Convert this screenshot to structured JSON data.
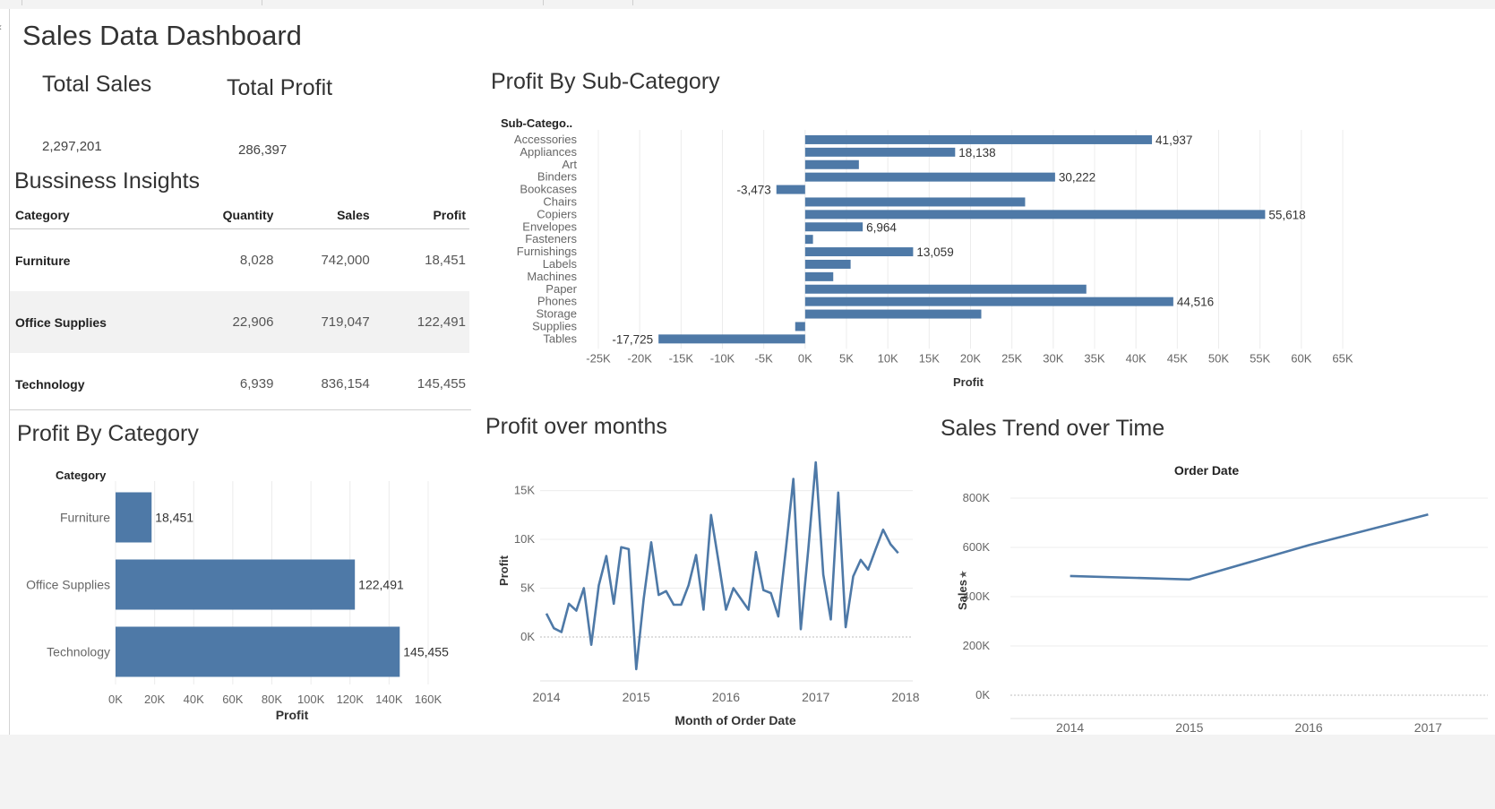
{
  "dashboard": {
    "title": "Sales Data Dashboard"
  },
  "kpis": {
    "total_sales": {
      "label": "Total Sales",
      "value": "2,297,201"
    },
    "total_profit": {
      "label": "Total Profit",
      "value": "286,397"
    }
  },
  "insights": {
    "title": "Bussiness Insights",
    "columns": [
      "Category",
      "Quantity",
      "Sales",
      "Profit"
    ],
    "rows": [
      [
        "Furniture",
        "8,028",
        "742,000",
        "18,451"
      ],
      [
        "Office Supplies",
        "22,906",
        "719,047",
        "122,491"
      ],
      [
        "Technology",
        "6,939",
        "836,154",
        "145,455"
      ]
    ]
  },
  "colors": {
    "bar": "#4e79a7",
    "grid": "#ececec",
    "zero_line": "#bdbdbd"
  },
  "chart_data": [
    {
      "id": "subcat",
      "type": "bar",
      "orientation": "horizontal",
      "title": "Profit By Sub-Category",
      "row_header": "Sub-Catego..",
      "xlabel": "Profit",
      "xlim": [
        -25000,
        65000
      ],
      "xticks": [
        "-25K",
        "-20K",
        "-15K",
        "-10K",
        "-5K",
        "0K",
        "5K",
        "10K",
        "15K",
        "20K",
        "25K",
        "30K",
        "35K",
        "40K",
        "45K",
        "50K",
        "55K",
        "60K",
        "65K"
      ],
      "categories": [
        "Accessories",
        "Appliances",
        "Art",
        "Binders",
        "Bookcases",
        "Chairs",
        "Copiers",
        "Envelopes",
        "Fasteners",
        "Furnishings",
        "Labels",
        "Machines",
        "Paper",
        "Phones",
        "Storage",
        "Supplies",
        "Tables"
      ],
      "values": [
        41937,
        18138,
        6500,
        30222,
        -3473,
        26600,
        55618,
        6964,
        950,
        13059,
        5500,
        3400,
        34000,
        44516,
        21300,
        -1200,
        -17725
      ],
      "labels": [
        "41,937",
        "18,138",
        "",
        "30,222",
        "-3,473",
        "",
        "55,618",
        "6,964",
        "",
        "13,059",
        "",
        "",
        "",
        "44,516",
        "",
        "",
        "-17,725"
      ],
      "grid": true,
      "legend": "none"
    },
    {
      "id": "category",
      "type": "bar",
      "orientation": "horizontal",
      "title": "Profit By Category",
      "row_header": "Category",
      "xlabel": "Profit",
      "xlim": [
        0,
        160000
      ],
      "xticks": [
        "0K",
        "20K",
        "40K",
        "60K",
        "80K",
        "100K",
        "120K",
        "140K",
        "160K"
      ],
      "categories": [
        "Furniture",
        "Office Supplies",
        "Technology"
      ],
      "values": [
        18451,
        122491,
        145455
      ],
      "labels": [
        "18,451",
        "122,491",
        "145,455"
      ],
      "grid": true,
      "legend": "none"
    },
    {
      "id": "months",
      "type": "line",
      "title": "Profit over months",
      "xlabel": "Month of Order Date",
      "ylabel": "Profit",
      "ylim": [
        -4500,
        17900
      ],
      "yticks": [
        "0K",
        "5K",
        "10K",
        "15K"
      ],
      "xticks": [
        "2014",
        "2015",
        "2016",
        "2017",
        "2018"
      ],
      "x": [
        2014.0,
        2014.083,
        2014.167,
        2014.25,
        2014.333,
        2014.417,
        2014.5,
        2014.583,
        2014.667,
        2014.75,
        2014.833,
        2014.917,
        2015.0,
        2015.083,
        2015.167,
        2015.25,
        2015.333,
        2015.417,
        2015.5,
        2015.583,
        2015.667,
        2015.75,
        2015.833,
        2015.917,
        2016.0,
        2016.083,
        2016.167,
        2016.25,
        2016.333,
        2016.417,
        2016.5,
        2016.583,
        2016.667,
        2016.75,
        2016.833,
        2016.917,
        2017.0,
        2017.083,
        2017.167,
        2017.25,
        2017.333,
        2017.417,
        2017.5,
        2017.583,
        2017.667,
        2017.75,
        2017.833,
        2017.917
      ],
      "values": [
        2400,
        900,
        500,
        3400,
        2700,
        5000,
        -800,
        5300,
        8300,
        3400,
        9200,
        9000,
        -3300,
        3900,
        9700,
        4300,
        4700,
        3300,
        3300,
        5300,
        8400,
        2800,
        12500,
        7700,
        2800,
        5000,
        3900,
        2800,
        8700,
        4800,
        4500,
        2100,
        9000,
        16200,
        800,
        9000,
        17900,
        6400,
        1800,
        14800,
        1000,
        6200,
        7900,
        6900,
        9000,
        11000,
        9500,
        8600
      ],
      "grid": true,
      "legend": "none"
    },
    {
      "id": "trend",
      "type": "line",
      "title": "Sales Trend over Time",
      "top_label": "Order Date",
      "ylabel": "Sales",
      "ylim": [
        0,
        800000
      ],
      "yticks": [
        "0K",
        "200K",
        "400K",
        "600K",
        "800K"
      ],
      "xticks": [
        "2014",
        "2015",
        "2016",
        "2017"
      ],
      "x": [
        2014,
        2015,
        2016,
        2017
      ],
      "values": [
        484000,
        470000,
        609000,
        734000
      ],
      "grid": true,
      "legend": "none"
    }
  ]
}
